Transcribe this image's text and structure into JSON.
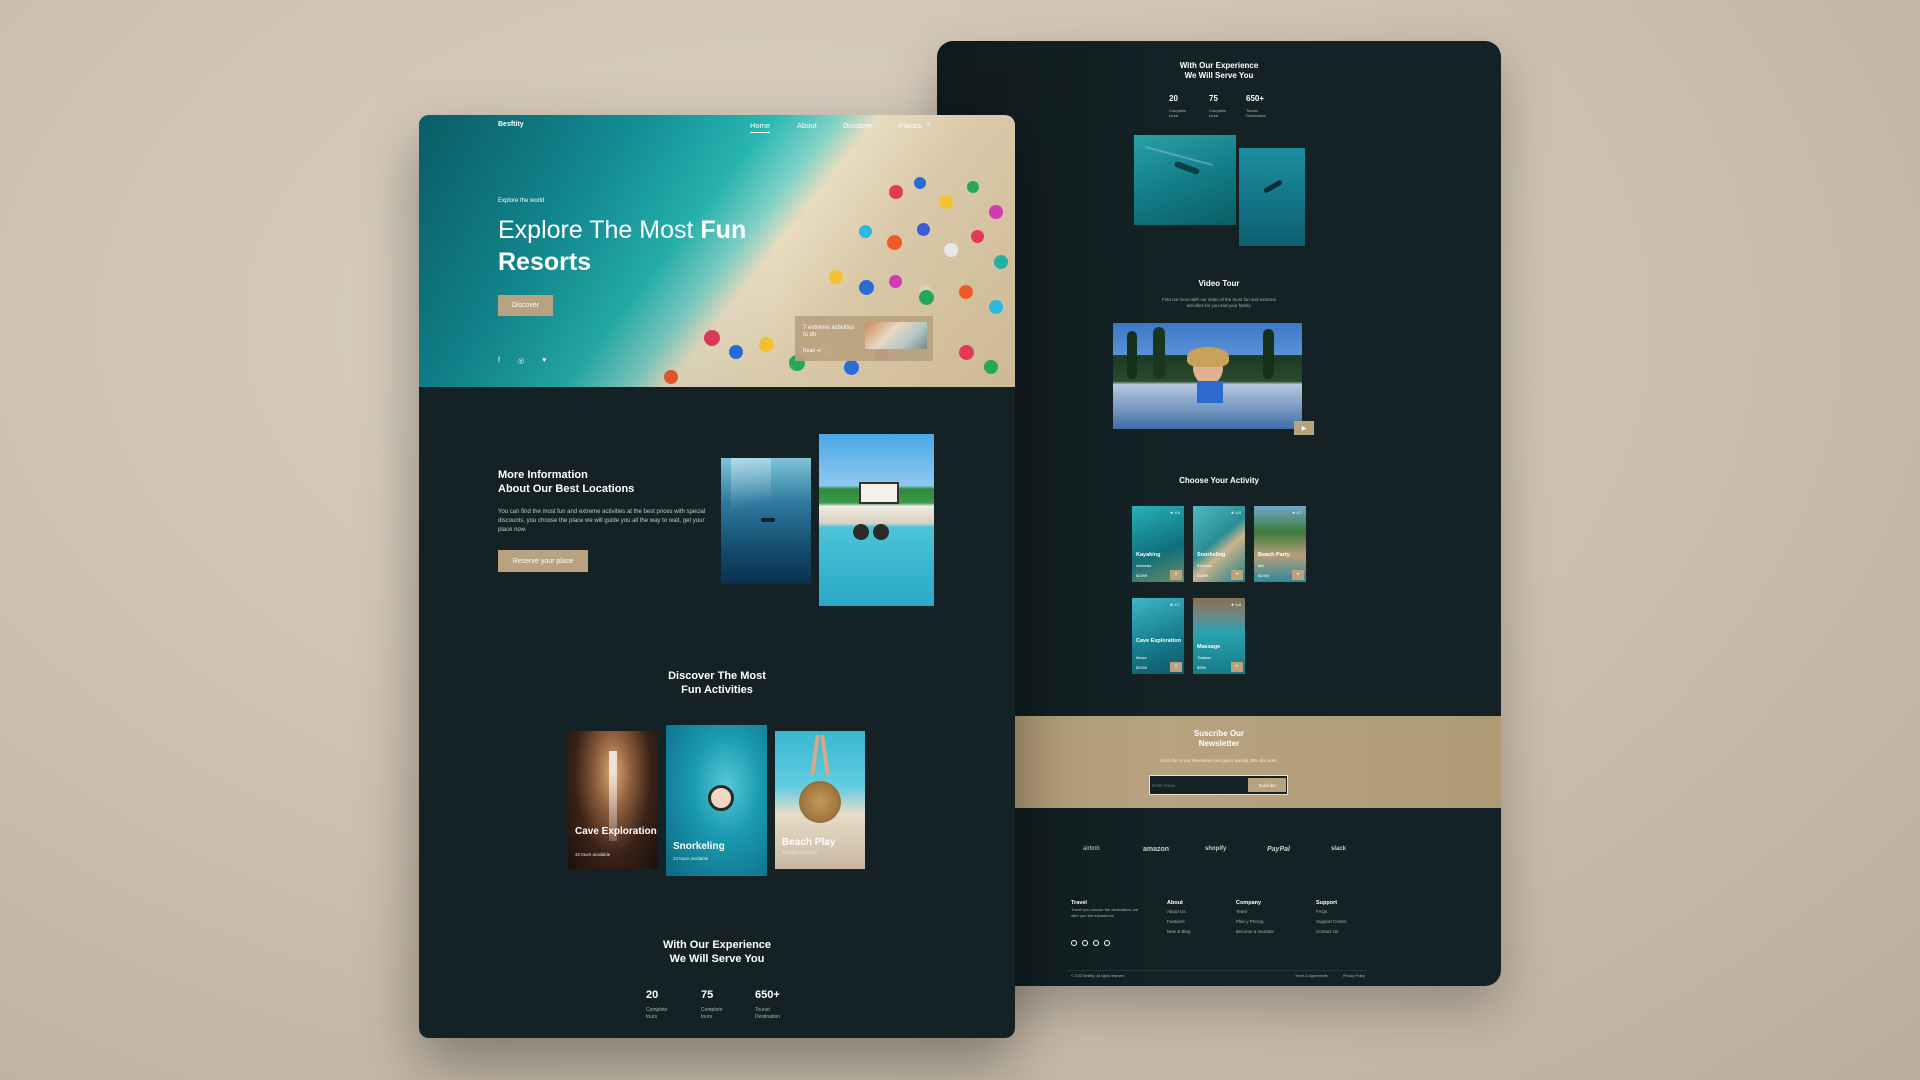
{
  "front": {
    "nav": {
      "brand": "Besftity",
      "links": [
        "Home",
        "About",
        "Discover",
        "Places"
      ],
      "search_icon": "search-icon"
    },
    "hero": {
      "eyebrow": "Explore the world",
      "title_line1_regular": "Explore The Most ",
      "title_line1_bold": "Fun",
      "title_line2": "Resorts",
      "discover_btn": "Discover",
      "promo_title": "7 extreme activities to do",
      "promo_link": "Read",
      "social_icons": [
        "facebook-icon",
        "instagram-icon",
        "twitter-icon"
      ]
    },
    "info": {
      "title_line1": "More Information",
      "title_line2": "About Our Best Locations",
      "body": "You can find the most fun and extreme activities at the best prices with special discounts, you choose the place we will guide you all the way to wait, get your place now.",
      "cta": "Reserve your place"
    },
    "activities": {
      "title_line1": "Discover The Most",
      "title_line2": "Fun Activities",
      "cards": [
        {
          "title": "Cave Exploration",
          "sub": "32 tours available"
        },
        {
          "title": "Snorkeling",
          "sub": "24 tours available"
        },
        {
          "title": "Beach Play",
          "sub": "15 tours available"
        }
      ]
    },
    "experience": {
      "title_line1": "With Our Experience",
      "title_line2": "We Will Serve You",
      "stats": [
        {
          "num": "20",
          "label_line1": "Complete",
          "label_line2": "tours"
        },
        {
          "num": "75",
          "label_line1": "Complete",
          "label_line2": "tours"
        },
        {
          "num": "650+",
          "label_line1": "Tourist",
          "label_line2": "Destination"
        }
      ]
    }
  },
  "back": {
    "experience": {
      "title_line1": "With Our Experience",
      "title_line2": "We Will Serve You",
      "stats": [
        {
          "num": "20",
          "label_line1": "Complete",
          "label_line2": "tours"
        },
        {
          "num": "75",
          "label_line1": "Complete",
          "label_line2": "tours"
        },
        {
          "num": "650+",
          "label_line1": "Tourist",
          "label_line2": "Destination"
        }
      ]
    },
    "video": {
      "title": "Video Tour",
      "body_line1": "Find out more with our video of the most fun and extreme",
      "body_line2": "activities for you and your family."
    },
    "choose": {
      "title": "Choose Your Activity",
      "cards": [
        {
          "name": "Kayaking",
          "sub": "Indonesia",
          "price": "$2499",
          "rating": "4.8"
        },
        {
          "name": "Snorkeling",
          "sub": "Bahamas",
          "price": "$1899",
          "rating": "4.9"
        },
        {
          "name": "Beach Party",
          "sub": "Bali",
          "price": "$1499",
          "rating": "4.7"
        },
        {
          "name": "Cave Exploration",
          "sub": "Mexico",
          "price": "$2099",
          "rating": "4.7"
        },
        {
          "name": "Massage",
          "sub": "Thailand",
          "price": "$999",
          "rating": "4.8"
        }
      ]
    },
    "newsletter": {
      "title_line1": "Suscribe Our",
      "title_line2": "Newsletter",
      "body": "Suscribe to our Newsletter and get a special 30% discount.",
      "placeholder": "Enter email",
      "button": "Suscribe"
    },
    "brands": [
      "airbnb",
      "amazon",
      "shopify",
      "PayPal",
      "slack"
    ],
    "footer": {
      "travel": {
        "title": "Travel",
        "body": "Travel you choose the destination, we offer you the experience."
      },
      "about": {
        "title": "About",
        "links": [
          "About Us",
          "Features",
          "New & Blog"
        ]
      },
      "company": {
        "title": "Company",
        "links": [
          "Team",
          "Plan y Pricing",
          "Become a member"
        ]
      },
      "support": {
        "title": "Support",
        "links": [
          "FAQs",
          "Support Center",
          "Contact Us"
        ]
      },
      "copyright": "© 2022 Besftity. All rights reserved",
      "terms": "Terms & Agreements",
      "privacy": "Privacy Policy"
    }
  },
  "colors": {
    "background": "#cbbfae",
    "dark": "#142225",
    "gold": "#b8a27f",
    "teal": "#1599a0"
  }
}
